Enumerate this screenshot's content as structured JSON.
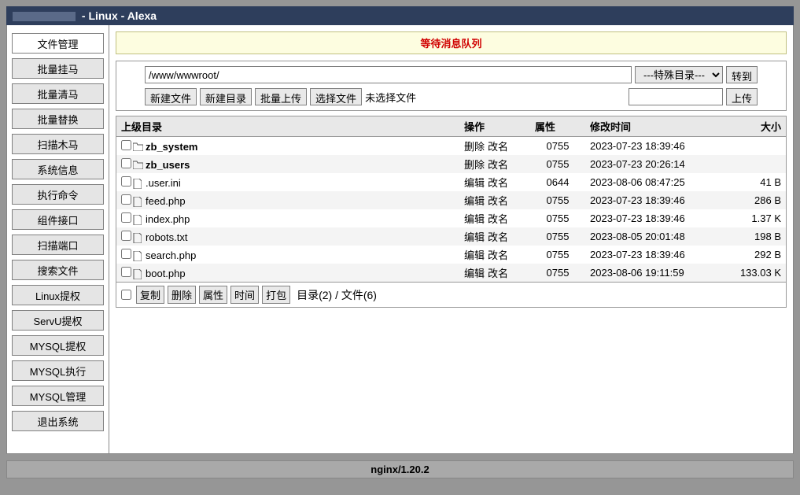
{
  "titlebar": {
    "suffix": " - Linux - Alexa"
  },
  "sidebar": {
    "items": [
      {
        "label": "文件管理",
        "active": true
      },
      {
        "label": "批量挂马"
      },
      {
        "label": "批量清马"
      },
      {
        "label": "批量替换"
      },
      {
        "label": "扫描木马"
      },
      {
        "label": "系统信息"
      },
      {
        "label": "执行命令"
      },
      {
        "label": "组件接口"
      },
      {
        "label": "扫描端口"
      },
      {
        "label": "搜索文件"
      },
      {
        "label": "Linux提权"
      },
      {
        "label": "ServU提权"
      },
      {
        "label": "MYSQL提权"
      },
      {
        "label": "MYSQL执行"
      },
      {
        "label": "MYSQL管理"
      },
      {
        "label": "退出系统"
      }
    ]
  },
  "msgbar": {
    "text": "等待消息队列"
  },
  "pathbar": {
    "path_value": "/www/wwwroot/",
    "special_dir": "---特殊目录---",
    "goto_label": "转到",
    "new_file": "新建文件",
    "new_dir": "新建目录",
    "batch_upload": "批量上传",
    "choose_file": "选择文件",
    "no_file_selected": "未选择文件",
    "upload_label": "上传"
  },
  "table": {
    "headers": {
      "parent": "上级目录",
      "op": "操作",
      "attr": "属性",
      "mtime": "修改时间",
      "size": "大小"
    },
    "rows": [
      {
        "type": "dir",
        "name": "zb_system",
        "ops": "删除 改名",
        "attr": "0755",
        "mtime": "2023-07-23 18:39:46",
        "size": ""
      },
      {
        "type": "dir",
        "name": "zb_users",
        "ops": "删除 改名",
        "attr": "0755",
        "mtime": "2023-07-23 20:26:14",
        "size": ""
      },
      {
        "type": "file",
        "name": ".user.ini",
        "ops": "编辑 改名",
        "attr": "0644",
        "mtime": "2023-08-06 08:47:25",
        "size": "41 B"
      },
      {
        "type": "file",
        "name": "feed.php",
        "ops": "编辑 改名",
        "attr": "0755",
        "mtime": "2023-07-23 18:39:46",
        "size": "286 B"
      },
      {
        "type": "file",
        "name": "index.php",
        "ops": "编辑 改名",
        "attr": "0755",
        "mtime": "2023-07-23 18:39:46",
        "size": "1.37 K"
      },
      {
        "type": "file",
        "name": "robots.txt",
        "ops": "编辑 改名",
        "attr": "0755",
        "mtime": "2023-08-05 20:01:48",
        "size": "198 B"
      },
      {
        "type": "file",
        "name": "search.php",
        "ops": "编辑 改名",
        "attr": "0755",
        "mtime": "2023-07-23 18:39:46",
        "size": "292 B"
      },
      {
        "type": "file",
        "name": "boot.php",
        "ops": "编辑 改名",
        "attr": "0755",
        "mtime": "2023-08-06 19:11:59",
        "size": "133.03 K",
        "highlight": true
      }
    ]
  },
  "footer_ops": {
    "copy": "复制",
    "delete": "删除",
    "attr": "属性",
    "time": "时间",
    "pack": "打包",
    "summary": "目录(2) / 文件(6)"
  },
  "statusbar": {
    "text": "nginx/1.20.2"
  }
}
